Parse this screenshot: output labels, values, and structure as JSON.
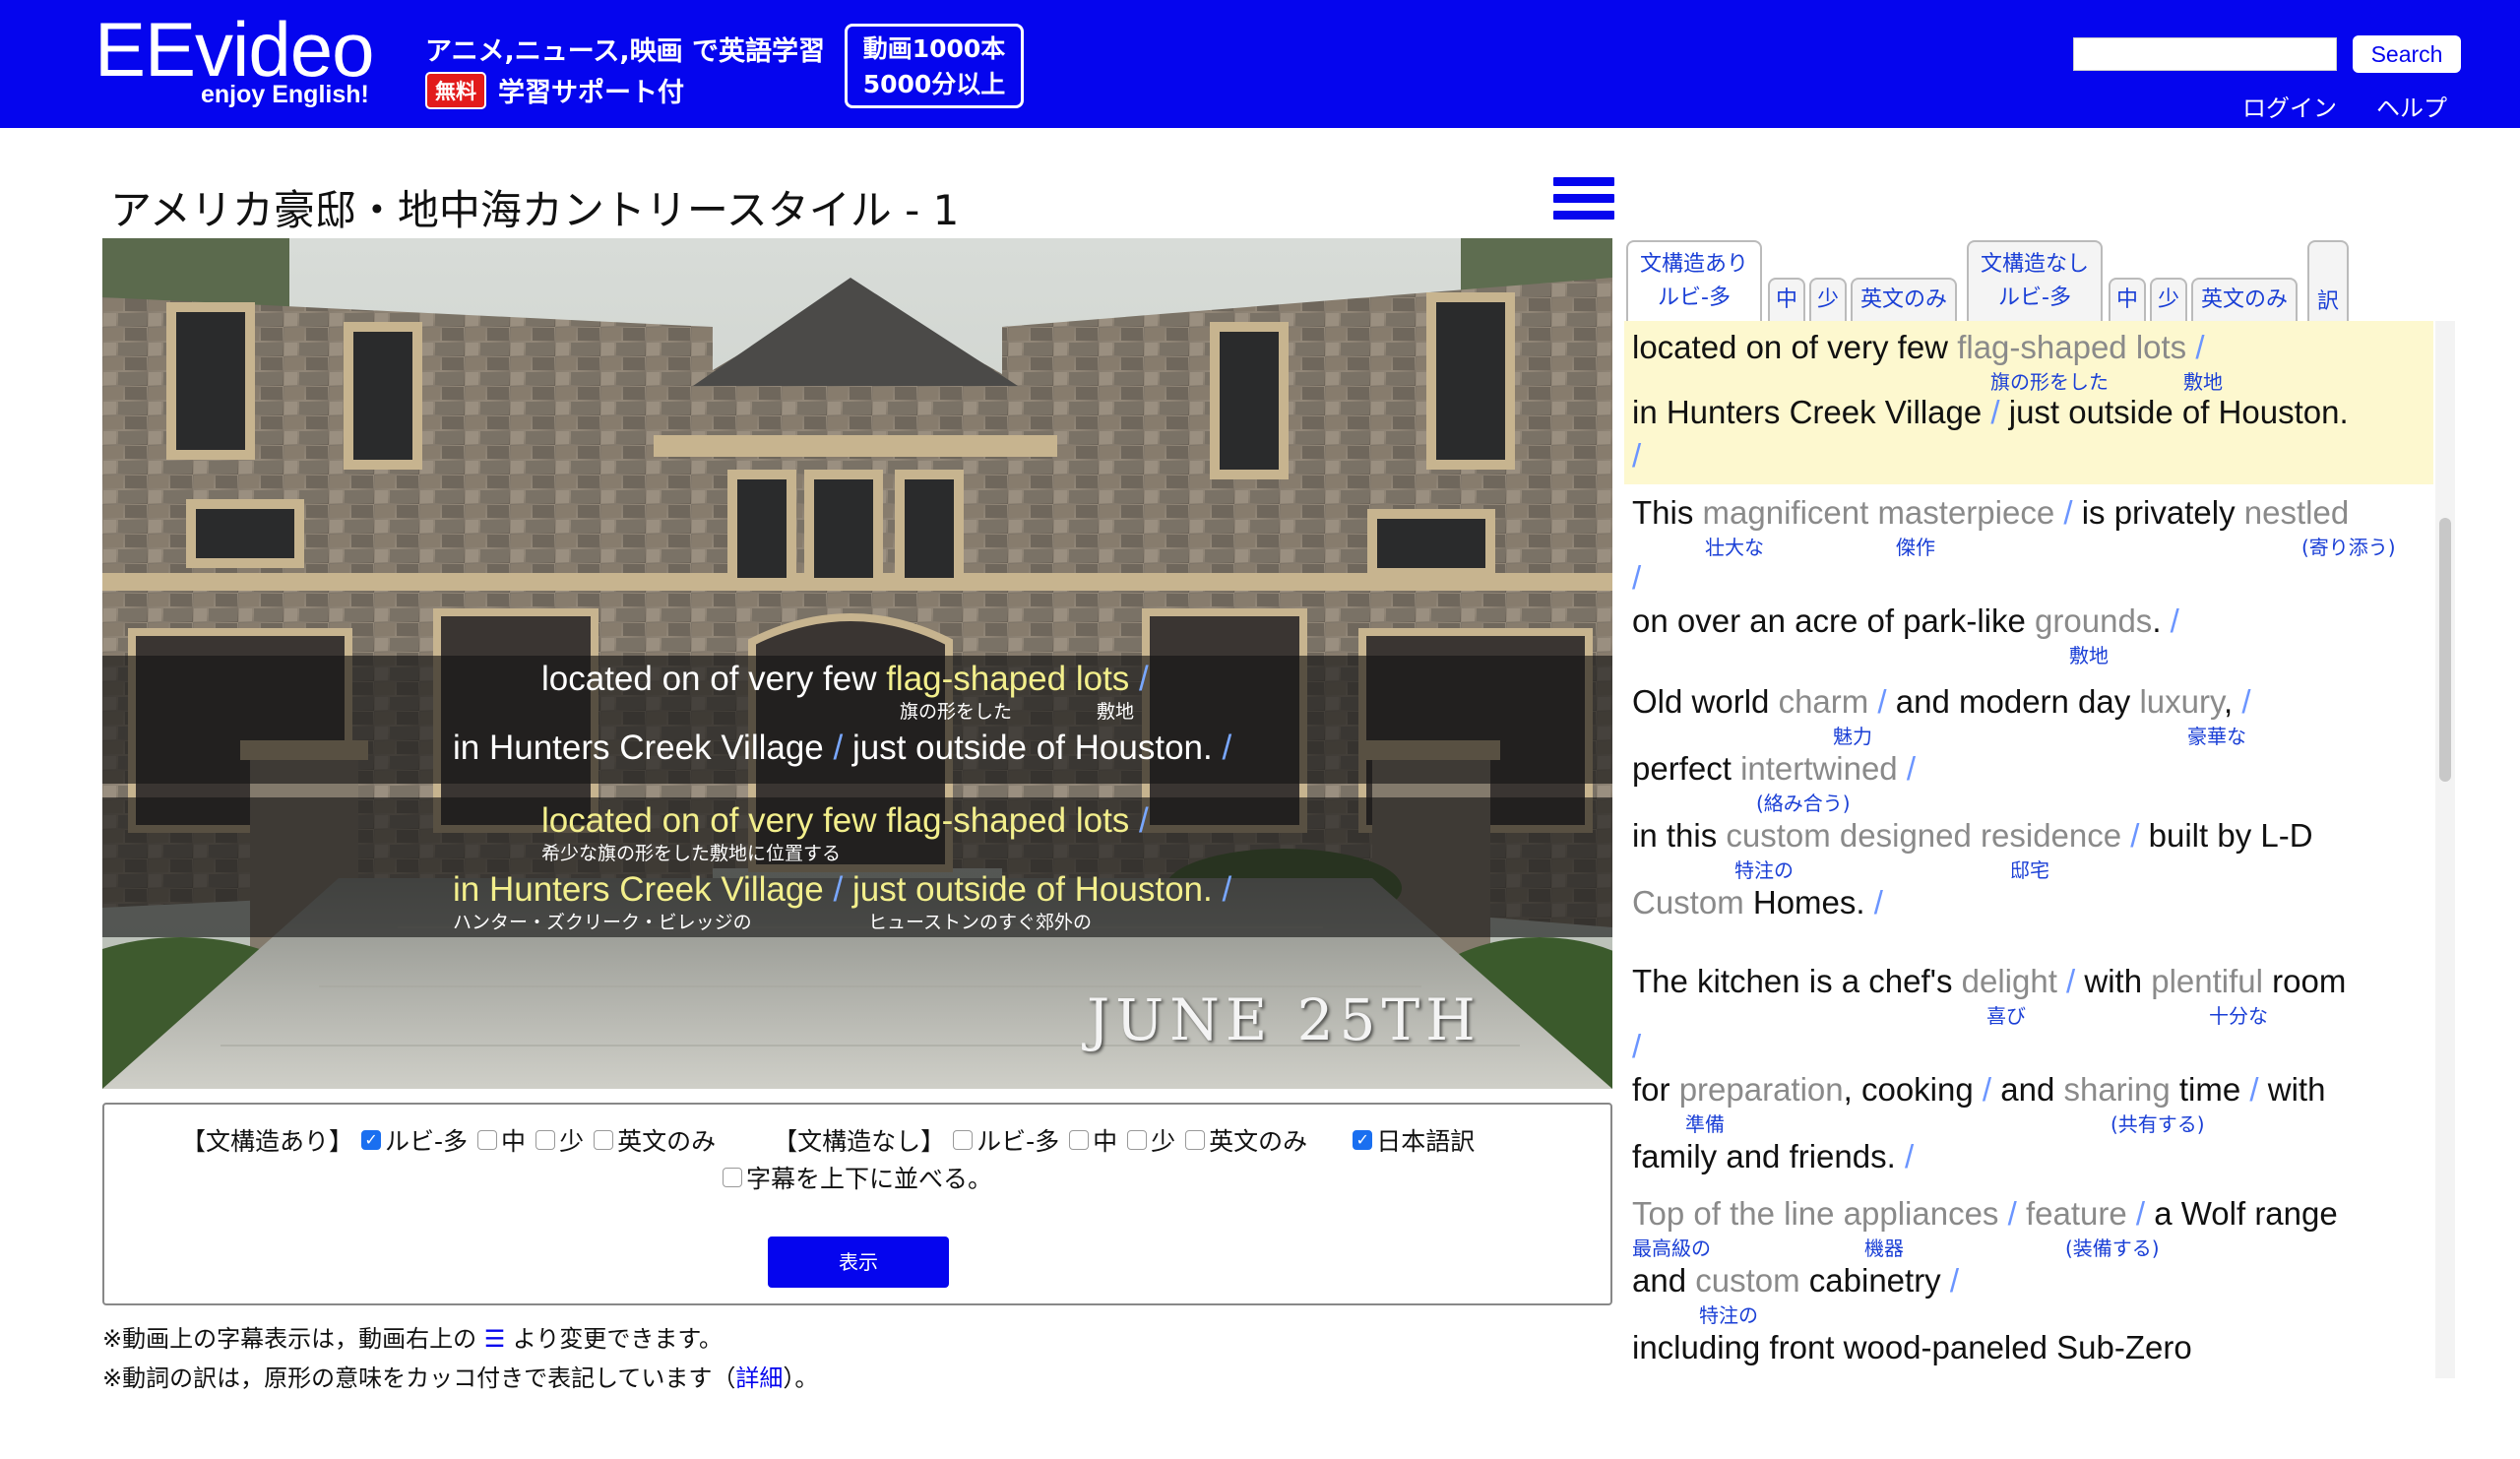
{
  "header": {
    "logo_main": "EEvideo",
    "logo_sub": "enjoy English!",
    "tagline": "アニメ,ニュース,映画 で英語学習",
    "free_badge": "無料",
    "support": "学習サポート付",
    "promo_line1": "動画1000本",
    "promo_line2": "5000分以上",
    "search_placeholder": "",
    "search_button": "Search",
    "login": "ログイン",
    "help": "ヘルプ"
  },
  "page": {
    "title": "アメリカ豪邸・地中海カントリースタイル - 1"
  },
  "video": {
    "date_overlay": "JUNE 25TH",
    "subtitle_ruby": {
      "line1": "located on of very few ",
      "line1_hl": "flag-shaped lots",
      "line1_end": " /",
      "ruby_flag": "旗の形をした",
      "ruby_lot": "敷地",
      "line2a": "in Hunters Creek Village ",
      "line2b": "/ ",
      "line2c": "just outside of Houston. ",
      "line2d": "/"
    },
    "subtitle_jp": {
      "line1": "located on of very few flag-shaped lots ",
      "line1_end": "/",
      "line1_tr": "希少な旗の形をした敷地に位置する",
      "line2a": "in Hunters Creek Village ",
      "line2b": "/ ",
      "line2c": "just outside of Houston. ",
      "line2d": "/",
      "line2_tr1": "ハンター・ズクリーク・ビレッジの",
      "line2_tr2": "ヒューストンのすぐ郊外の"
    }
  },
  "controls": {
    "group_with": "【文構造あり】",
    "group_without": "【文構造なし】",
    "opt_ruby_many": "ルビ-多",
    "opt_mid": "中",
    "opt_few": "少",
    "opt_english_only": "英文のみ",
    "opt_japanese": "日本語訳",
    "opt_stack": "字幕を上下に並べる。",
    "show_button": "表示",
    "state": {
      "with_ruby_many": true,
      "with_mid": false,
      "with_few": false,
      "with_en_only": false,
      "without_ruby_many": false,
      "without_mid": false,
      "without_few": false,
      "without_en_only": false,
      "japanese": true,
      "stack": false
    }
  },
  "notes": {
    "note1_a": "※動画上の字幕表示は，動画右上の ",
    "note1_icon": "☰",
    "note1_b": " より変更できます。",
    "note2_a": "※動詞の訳は，原形の意味をカッコ付きで表記しています（",
    "note2_link": "詳細",
    "note2_b": "）。"
  },
  "tabs": {
    "with_line1": "文構造あり",
    "with_line2": "ルビ-多",
    "mid": "中",
    "few": "少",
    "en_only": "英文のみ",
    "without_line1": "文構造なし",
    "without_line2": "ルビ-多",
    "translate": "訳"
  },
  "transcript": {
    "l1_a": "located on of very few ",
    "l1_g": "flag-shaped lots",
    "l1_s": " /",
    "r1_a": "旗の形をした",
    "r1_b": "敷地",
    "l2_a": "in Hunters Creek Village ",
    "l2_s": "/ ",
    "l2_b": "just outside of Houston.",
    "l3_s": "/",
    "l4_a": "This ",
    "l4_g1": "magnificent masterpiece",
    "l4_s1": " / ",
    "l4_b": "is privately ",
    "l4_g2": "nestled",
    "r4_a": "壮大な",
    "r4_b": "傑作",
    "r4_c": "(寄り添う)",
    "l5_s": "/",
    "l6_a": "on over an acre of park-like ",
    "l6_g": "grounds",
    "l6_b": ". ",
    "l6_s": "/",
    "r6_a": "敷地",
    "l7_a": "Old world ",
    "l7_g1": "charm",
    "l7_s1": " / ",
    "l7_b": "and modern day ",
    "l7_g2": "luxury",
    "l7_c": ", ",
    "l7_s2": "/",
    "r7_a": "魅力",
    "r7_b": "豪華な",
    "l8_a": "perfect ",
    "l8_g": "intertwined",
    "l8_s": " /",
    "r8_a": "(絡み合う)",
    "l9_a": "in this ",
    "l9_g": "custom designed residence",
    "l9_s": " / ",
    "l9_b": "built by L-D",
    "r9_a": "特注の",
    "r9_b": "邸宅",
    "l10_g": "Custom",
    "l10_a": " Homes. ",
    "l10_s": "/",
    "l11_a": "The kitchen is a chef's ",
    "l11_g1": "delight",
    "l11_s": " / ",
    "l11_b": "with ",
    "l11_g2": "plentiful",
    "l11_c": " room",
    "r11_a": "喜び",
    "r11_b": "十分な",
    "l12_s": "/",
    "l13_a": "for ",
    "l13_g1": "preparation",
    "l13_b": ", cooking ",
    "l13_s1": "/ ",
    "l13_c": "and ",
    "l13_g2": "sharing",
    "l13_d": " time ",
    "l13_s2": "/ ",
    "l13_e": "with",
    "r13_a": "準備",
    "r13_b": "(共有する)",
    "l14_a": "family and friends. ",
    "l14_s": "/",
    "l15_g1": "Top of the line appliances",
    "l15_s1": " / ",
    "l15_g2": "feature",
    "l15_s2": " / ",
    "l15_a": "a Wolf range",
    "r15_a": "最高級の",
    "r15_b": "機器",
    "r15_c": "(装備する)",
    "l16_a": "and ",
    "l16_g": "custom",
    "l16_b": " cabinetry ",
    "l16_s": "/",
    "r16_a": "特注の",
    "l17_a": "including front wood-paneled Sub-Zero"
  },
  "colors": {
    "brand": "#0505ee",
    "highlight_bg": "#fdf8cf",
    "vocab_gray": "#8a8a8a",
    "slash_blue": "#6b95ff",
    "ruby_blue": "#1a3fd6"
  }
}
